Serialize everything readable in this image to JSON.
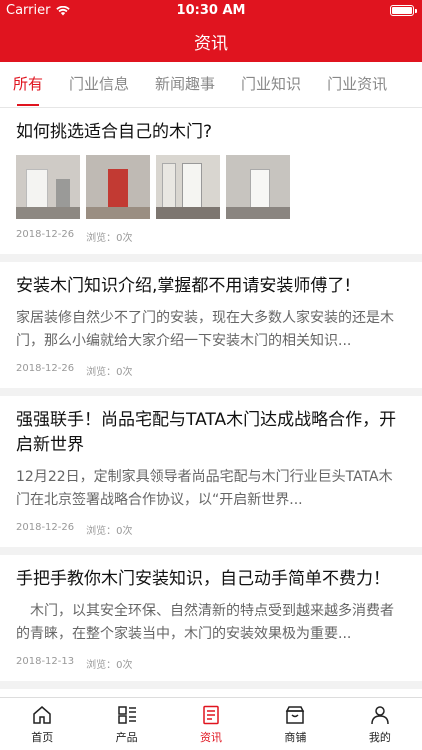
{
  "status": {
    "carrier": "Carrier",
    "time": "10:30 AM"
  },
  "header": {
    "title": "资讯"
  },
  "tabs": [
    {
      "label": "所有",
      "active": true
    },
    {
      "label": "门业信息",
      "active": false
    },
    {
      "label": "新闻趣事",
      "active": false
    },
    {
      "label": "门业知识",
      "active": false
    },
    {
      "label": "门业资讯",
      "active": false
    }
  ],
  "articles": [
    {
      "title": "如何挑选适合自己的木门?",
      "desc": "",
      "date": "2018-12-26",
      "views": "浏览：0次",
      "has_images": true
    },
    {
      "title": "安装木门知识介绍,掌握都不用请安装师傅了!",
      "desc": "家居装修自然少不了门的安装，现在大多数人家安装的还是木门，那么小编就给大家介绍一下安装木门的相关知识...",
      "date": "2018-12-26",
      "views": "浏览：0次",
      "has_images": false
    },
    {
      "title": "强强联手！尚品宅配与TATA木门达成战略合作，开启新世界",
      "desc": "12月22日，定制家具领导者尚品宅配与木门行业巨头TATA木门在北京签署战略合作协议，以“开启新世界...",
      "date": "2018-12-26",
      "views": "浏览：0次",
      "has_images": false
    },
    {
      "title": "手把手教你木门安装知识，自己动手简单不费力！",
      "desc": "　木门，以其安全环保、自然清新的特点受到越来越多消费者的青睐，在整个家装当中，木门的安装效果极为重要...",
      "date": "2018-12-13",
      "views": "浏览：0次",
      "has_images": false
    }
  ],
  "tabbar": [
    {
      "label": "首页",
      "icon": "home-icon",
      "active": false
    },
    {
      "label": "产品",
      "icon": "grid-list-icon",
      "active": false
    },
    {
      "label": "资讯",
      "icon": "news-icon",
      "active": true
    },
    {
      "label": "商铺",
      "icon": "shop-icon",
      "active": false
    },
    {
      "label": "我的",
      "icon": "user-icon",
      "active": false
    }
  ],
  "colors": {
    "accent": "#e0141f",
    "divider": "#f2f2f2",
    "muted": "#999999"
  }
}
